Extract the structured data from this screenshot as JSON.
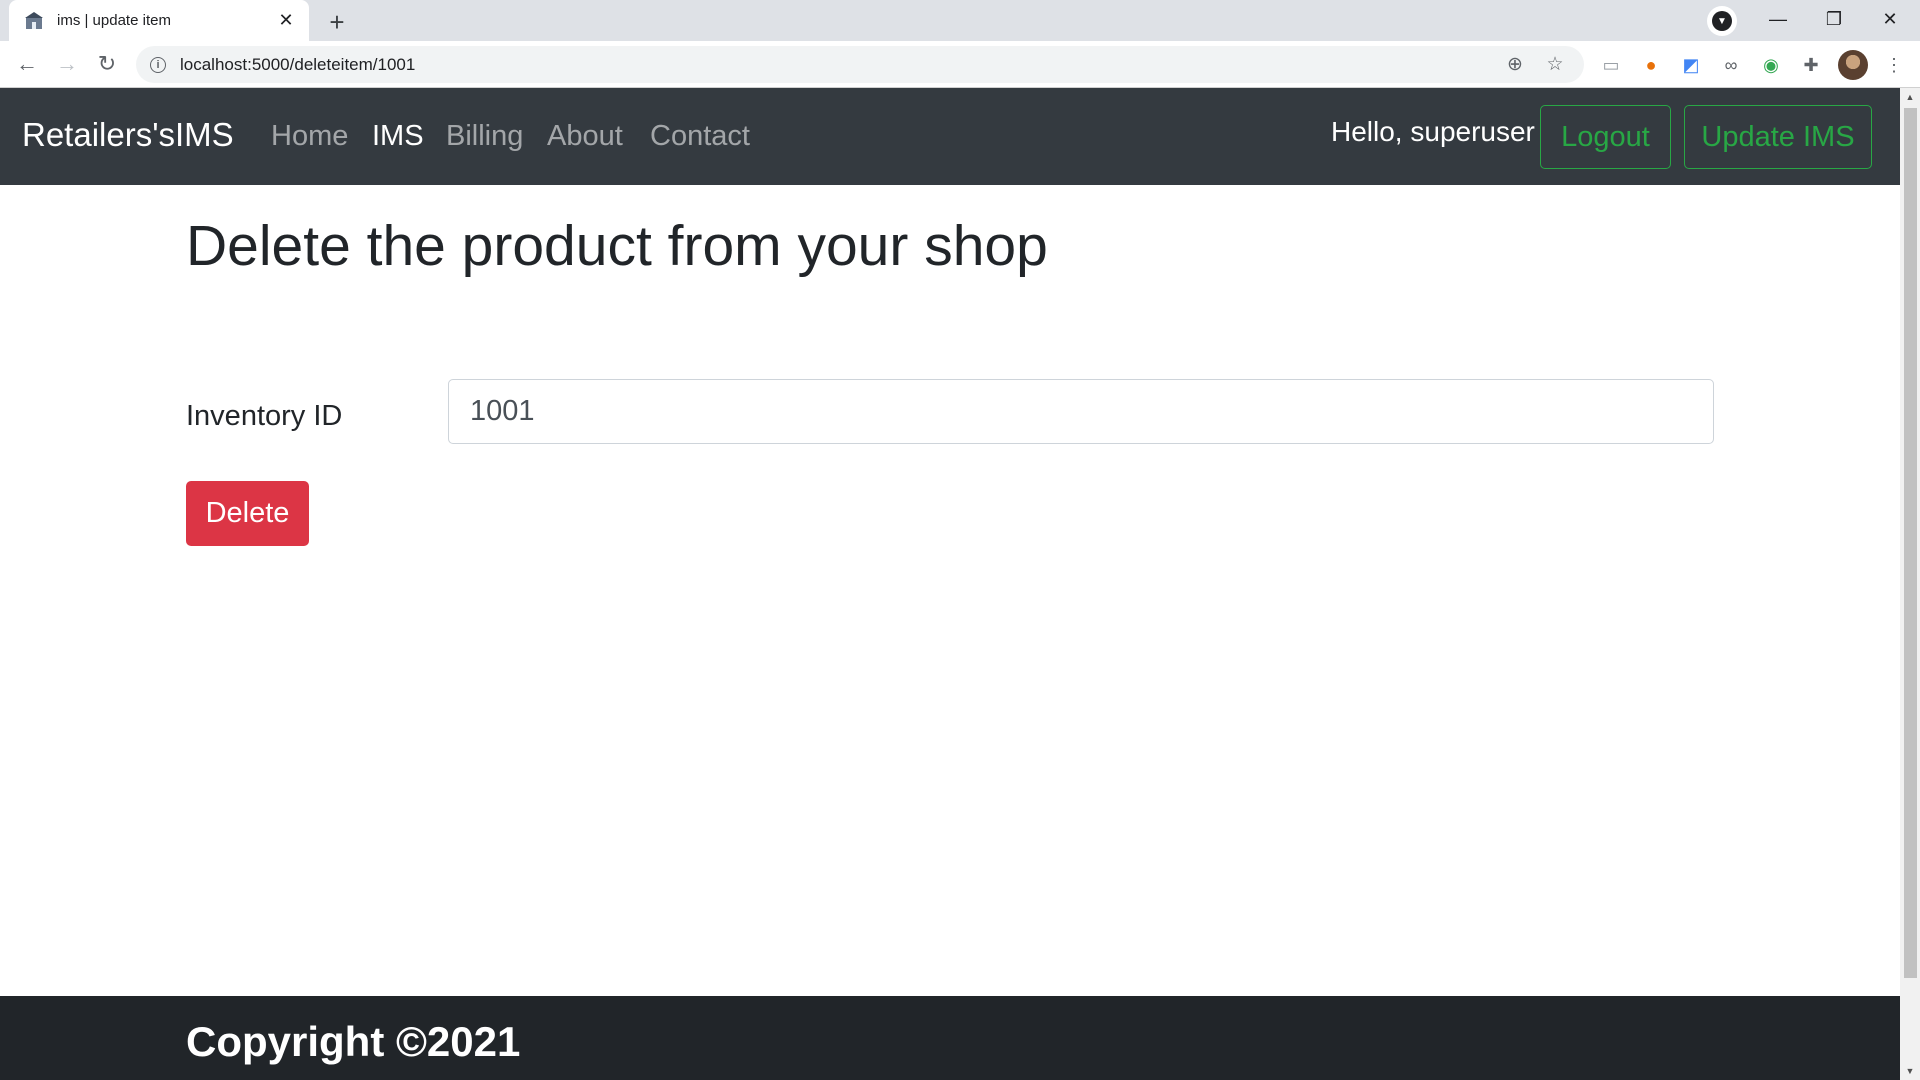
{
  "browser": {
    "tab_title": "ims | update item",
    "tab_close": "✕",
    "new_tab": "+",
    "url": "localhost:5000/deleteitem/1001",
    "window_controls": {
      "minimize": "—",
      "restore": "❐",
      "close": "✕"
    },
    "icons": [
      "back-icon",
      "forward-icon",
      "reload-icon",
      "info-icon",
      "zoom-icon",
      "bookmark-star-icon",
      "extensions-icon",
      "menu-icon"
    ]
  },
  "navbar": {
    "brand": "Retailers'sIMS",
    "links": [
      {
        "label": "Home"
      },
      {
        "label": "IMS"
      },
      {
        "label": "Billing"
      },
      {
        "label": "About"
      },
      {
        "label": "Contact"
      }
    ],
    "active": "IMS",
    "greeting": "Hello, superuser",
    "logout_label": "Logout",
    "update_label": "Update IMS"
  },
  "main": {
    "heading": "Delete the product from your shop",
    "field_label": "Inventory ID",
    "field_value": "1001",
    "delete_label": "Delete"
  },
  "footer": {
    "copyright": "Copyright ©2021"
  },
  "colors": {
    "navbar_bg": "#343a40",
    "footer_bg": "#212529",
    "danger": "#dc3545",
    "success": "#28a745"
  }
}
